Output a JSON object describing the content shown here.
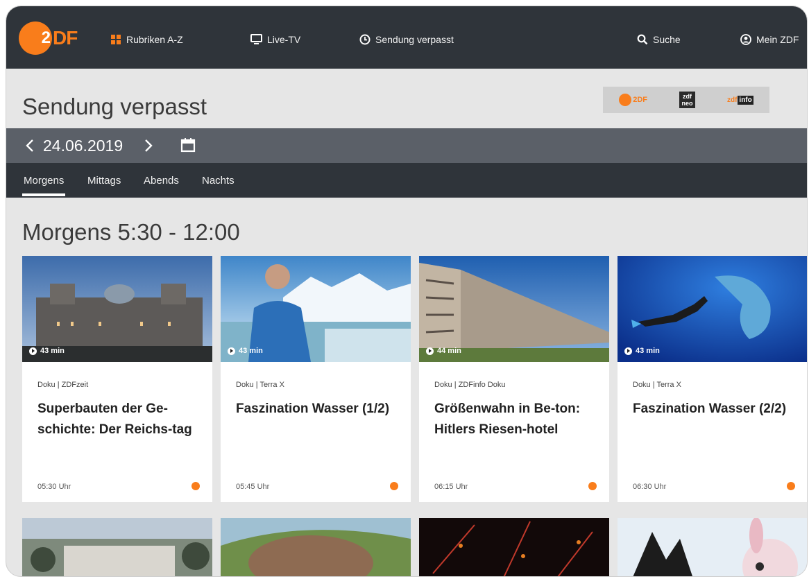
{
  "nav": {
    "logo_mark": "2",
    "logo_rest": "DF",
    "items": [
      {
        "label": "Rubriken A-Z"
      },
      {
        "label": "Live-TV"
      },
      {
        "label": "Sendung verpasst"
      },
      {
        "label": "Suche"
      },
      {
        "label": "Mein ZDF"
      }
    ]
  },
  "page": {
    "title": "Sendung verpasst",
    "date": "24.06.2019",
    "section_title": "Morgens 5:30 - 12:00"
  },
  "senders": {
    "zdf": "2DF",
    "neo_top": "zdf",
    "neo_bottom": "neo",
    "info_zdf": "zdf",
    "info_label": "info"
  },
  "tabs": [
    {
      "label": "Morgens",
      "active": true
    },
    {
      "label": "Mittags",
      "active": false
    },
    {
      "label": "Abends",
      "active": false
    },
    {
      "label": "Nachts",
      "active": false
    }
  ],
  "cards": [
    {
      "category": "Doku | ZDFzeit",
      "title": "Superbauten der Ge-schichte: Der Reichs-tag",
      "duration": "43 min",
      "time": "05:30 Uhr"
    },
    {
      "category": "Doku | Terra X",
      "title": "Faszination Wasser (1/2)",
      "duration": "43 min",
      "time": "05:45 Uhr"
    },
    {
      "category": "Doku | ZDFinfo Doku",
      "title": "Größenwahn in Be-ton: Hitlers Riesen-hotel",
      "duration": "44 min",
      "time": "06:15 Uhr"
    },
    {
      "category": "Doku | Terra X",
      "title": "Faszination Wasser (2/2)",
      "duration": "43 min",
      "time": "06:30 Uhr"
    }
  ],
  "colors": {
    "accent": "#f97d1b",
    "nav_bg": "#2f343a",
    "date_bar_bg": "#5b6068",
    "page_bg": "#e6e6e6"
  }
}
